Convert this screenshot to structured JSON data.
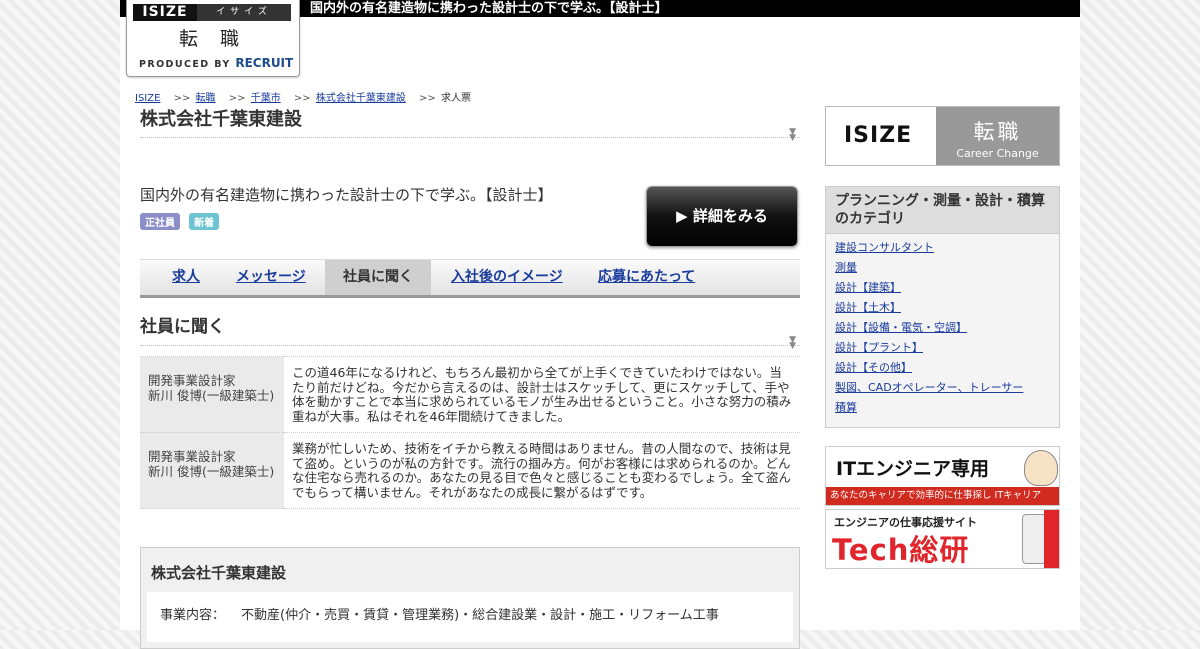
{
  "header": {
    "tagline": "国内外の有名建造物に携わった設計士の下で学ぶ。【設計士】",
    "logo": {
      "isize": "ISIZE",
      "kana": "イサイズ",
      "tenshoku": "転 職",
      "produced": "PRODUCED BY",
      "recruit": "RECRUIT"
    }
  },
  "breadcrumb": {
    "items": [
      {
        "label": "ISIZE",
        "link": true
      },
      {
        "label": "転職",
        "link": true
      },
      {
        "label": "千葉市",
        "link": true
      },
      {
        "label": "株式会社千葉東建設",
        "link": true
      },
      {
        "label": "求人票",
        "link": false
      }
    ],
    "separator": ">>"
  },
  "main": {
    "company_title": "株式会社千葉東建設",
    "catch": "国内外の有名建造物に携わった設計士の下で学ぶ。【設計士】",
    "tags": [
      "正社員",
      "新着"
    ],
    "detail_button": "▶ 詳細をみる",
    "tabs": [
      {
        "label": "求人",
        "active": false
      },
      {
        "label": "メッセージ",
        "active": false
      },
      {
        "label": "社員に聞く",
        "active": true
      },
      {
        "label": "入社後のイメージ",
        "active": false
      },
      {
        "label": "応募にあたって",
        "active": false
      }
    ],
    "section_title": "社員に聞く",
    "interviews": [
      {
        "who": "開発事業設計家\n新川 俊博(一級建築士)",
        "answer": "この道46年になるけれど、もちろん最初から全てが上手くできていたわけではない。当たり前だけどね。今だから言えるのは、設計士はスケッチして、更にスケッチして、手や体を動かすことで本当に求められているモノが生み出せるということ。小さな努力の積み重ねが大事。私はそれを46年間続けてきました。"
      },
      {
        "who": "開発事業設計家\n新川 俊博(一級建築士)",
        "answer": "業務が忙しいため、技術をイチから教える時間はありません。昔の人間なので、技術は見て盗め。というのが私の方針です。流行の掴み方。何がお客様には求められるのか。どんな住宅なら売れるのか。あなたの見る目で色々と感じることも変わるでしょう。全て盗んでもらって構いません。それがあなたの成長に繋がるはずです。"
      }
    ],
    "company_box": {
      "name": "株式会社千葉東建設",
      "business_label": "事業内容：",
      "business_value": "不動産(仲介・売買・賃貸・管理業務)・総合建設業・設計・施工・リフォーム工事"
    }
  },
  "sidebar": {
    "banner": {
      "isize": "ISIZE",
      "tenshoku": "転職",
      "career": "Career Change"
    },
    "category": {
      "title": "プランニング・測量・設計・積算のカテゴリ",
      "items": [
        "建設コンサルタント",
        "測量",
        "設計【建築】",
        "設計【土木】",
        "設計【設備・電気・空調】",
        "設計【プラント】",
        "設計【その他】",
        "製図、CADオペレーター、トレーサー",
        "積算"
      ]
    },
    "it_banner": {
      "title": "ITエンジニア専用",
      "bar": "あなたのキャリアで効率的に仕事探し ITキャリア"
    },
    "tech_banner": {
      "sub": "エンジニアの仕事応援サイト",
      "main": "Tech総研"
    }
  },
  "colors": {
    "link": "#1a3c9c",
    "tag_seishain": "#8c8fc7",
    "tag_new": "#6fc4d3",
    "it_bar": "#d12a1f",
    "tech_red": "#e0262b"
  }
}
